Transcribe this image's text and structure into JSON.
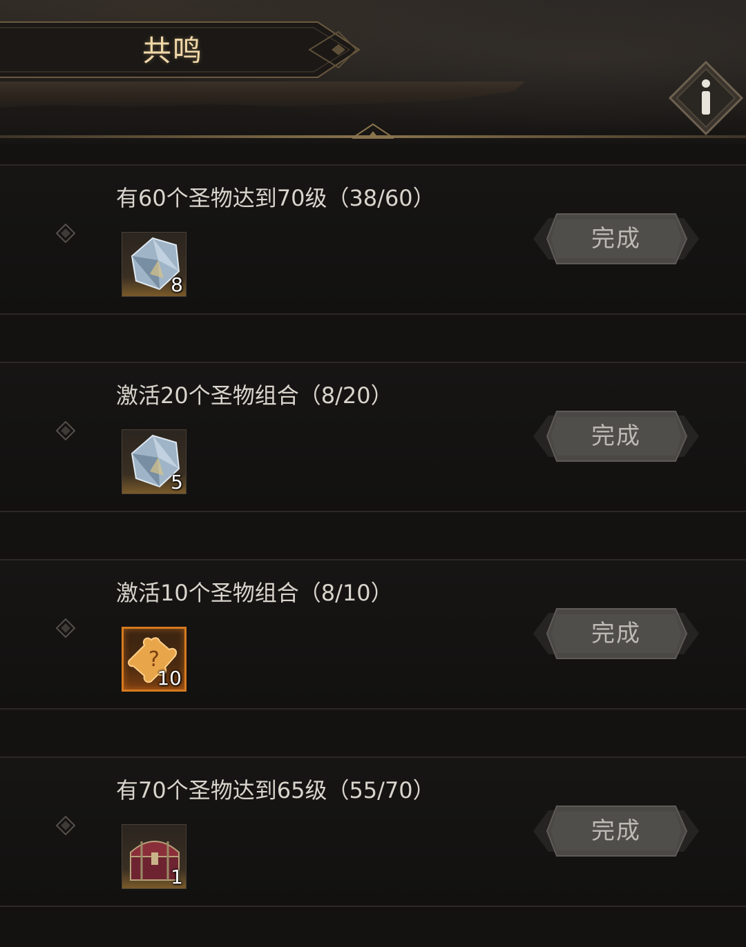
{
  "header": {
    "title": "共鸣",
    "info_icon": "info-icon"
  },
  "quests": [
    {
      "title": "有60个圣物达到70级（38/60）",
      "reward": {
        "icon": "crystal-icon",
        "count": "8"
      },
      "button_label": "完成"
    },
    {
      "title": "激活20个圣物组合（8/20）",
      "reward": {
        "icon": "crystal-icon",
        "count": "5"
      },
      "button_label": "完成"
    },
    {
      "title": "激活10个圣物组合（8/10）",
      "reward": {
        "icon": "puzzle-piece-icon",
        "count": "10"
      },
      "button_label": "完成"
    },
    {
      "title": "有70个圣物达到65级（55/70）",
      "reward": {
        "icon": "treasure-chest-icon",
        "count": "1"
      },
      "button_label": "完成"
    }
  ],
  "colors": {
    "background": "#131211",
    "title_gold": "#f0d8a8",
    "text": "#d9d5cd",
    "orange_frame": "#d77a1e"
  }
}
